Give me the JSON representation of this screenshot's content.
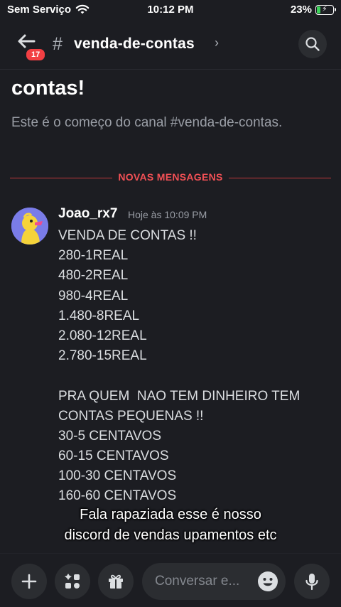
{
  "status_bar": {
    "carrier": "Sem Serviço",
    "time": "10:12 PM",
    "battery": "23%",
    "battery_level": 0.23
  },
  "header": {
    "back_badge": "17",
    "hash_symbol": "#",
    "channel_name": "venda-de-contas",
    "chevron": "›"
  },
  "welcome": {
    "title": "contas!",
    "subtitle": "Este é o começo do canal #venda-de-contas."
  },
  "divider": {
    "label": "NOVAS MENSAGENS"
  },
  "message": {
    "author": "Joao_rx7",
    "timestamp": "Hoje às 10:09 PM",
    "lines": [
      "VENDA DE CONTAS !!",
      "280-1REAL",
      "480-2REAL",
      "980-4REAL",
      "1.480-8REAL",
      "2.080-12REAL",
      "2.780-15REAL",
      "",
      "PRA QUEM  NAO TEM DINHEIRO TEM",
      "CONTAS PEQUENAS !!",
      "30-5 CENTAVOS",
      "60-15 CENTAVOS",
      "100-30 CENTAVOS",
      "160-60 CENTAVOS"
    ]
  },
  "caption": {
    "line1": "Fala rapaziada esse é nosso",
    "line2": "discord de vendas upamentos etc"
  },
  "composer": {
    "placeholder": "Conversar e..."
  },
  "icons": [
    "wifi-icon",
    "battery-icon",
    "back-arrow-icon",
    "search-icon",
    "plus-icon",
    "apps-icon",
    "gift-icon",
    "emoji-icon",
    "microphone-icon"
  ],
  "colors": {
    "background": "#1c1d22",
    "new_messages_red": "#f25055",
    "badge_red": "#f23f43",
    "battery_green": "#3dd35b",
    "avatar_bg": "#7a7ce8"
  }
}
